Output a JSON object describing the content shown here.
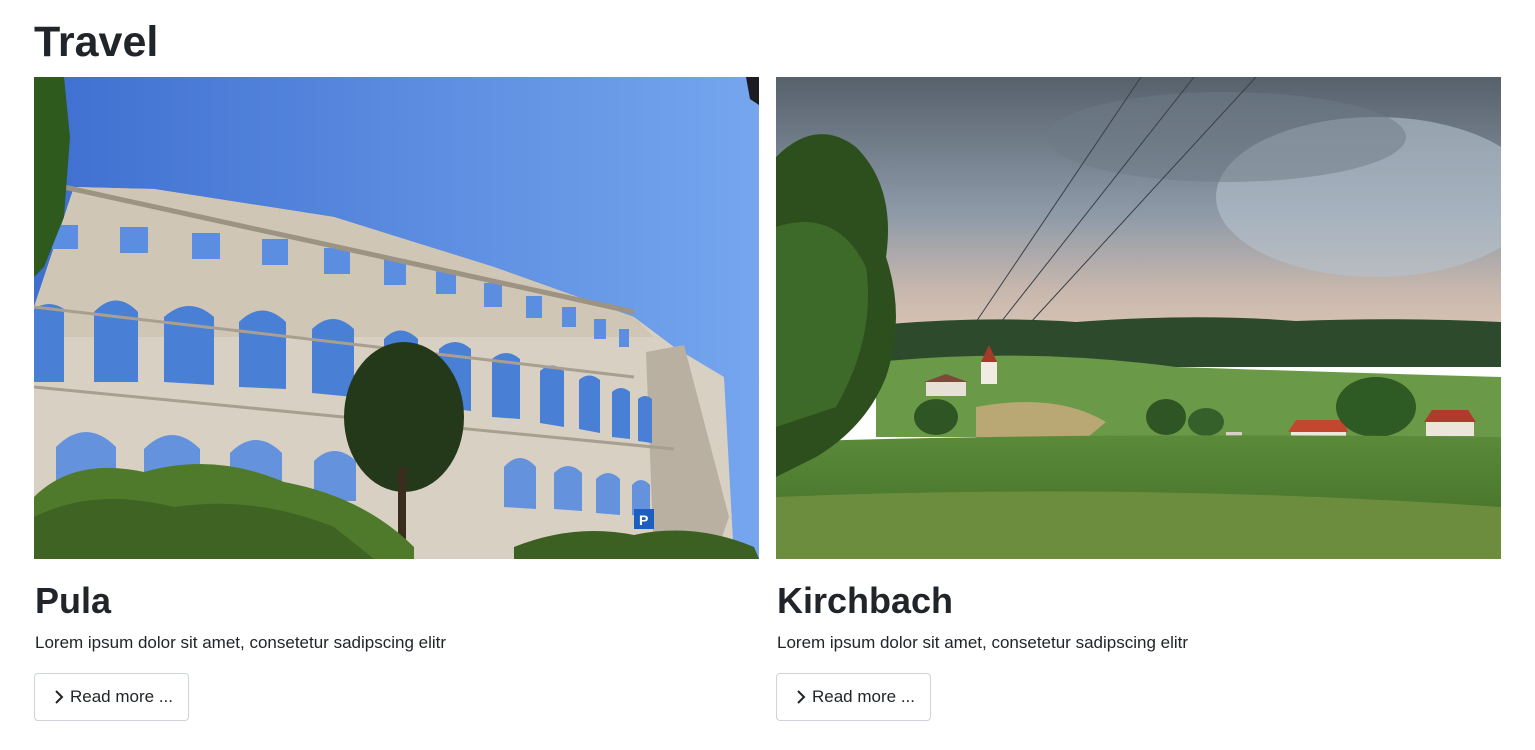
{
  "section": {
    "title": "Travel"
  },
  "cards": [
    {
      "title": "Pula",
      "text": "Lorem ipsum dolor sit amet, consetetur sadipscing elitr",
      "button_label": "Read more ...",
      "image_icon": "colosseum-photo",
      "image_alt": "Pula"
    },
    {
      "title": "Kirchbach",
      "text": "Lorem ipsum dolor sit amet, consetetur sadipscing elitr",
      "button_label": "Read more ...",
      "image_icon": "landscape-photo",
      "image_alt": "Kirchbach"
    }
  ]
}
